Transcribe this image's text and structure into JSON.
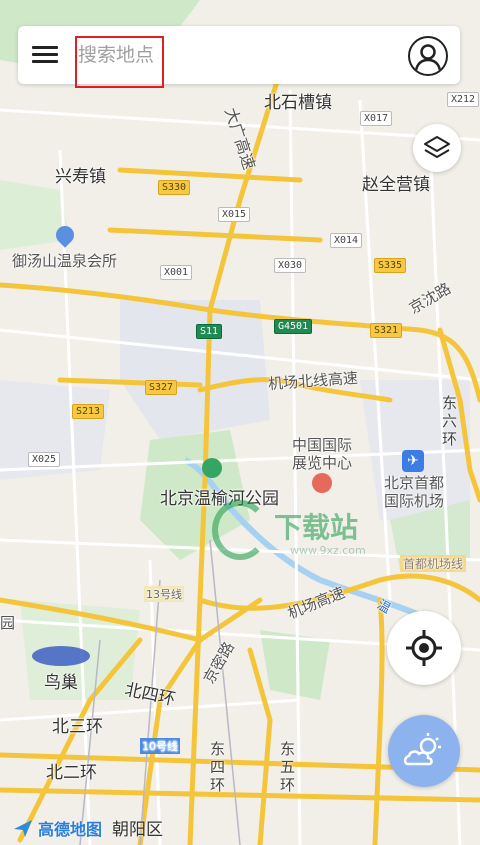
{
  "search": {
    "placeholder": "搜索地点"
  },
  "labels": {
    "beishicao": "北石槽镇",
    "xingshou": "兴寿镇",
    "zhaoquanying": "赵全营镇",
    "yutangshan": "御汤山温泉会所",
    "jingshen": "京沈路",
    "jichang_north": "机场北线高速",
    "expo": "中国国际\n展览中心",
    "wenyu": "北京温榆河公园",
    "airport": "北京首都\n国际机场",
    "airport_line": "首都机场线",
    "jichang_hw": "机场高速",
    "wen": "温",
    "yuan": "园",
    "niaochao": "鸟巢",
    "bei4": "北四环",
    "bei3": "北三环",
    "bei2": "北二环",
    "jingmi": "京密路",
    "line13": "13号线",
    "line10": "10号线",
    "dongliuhuan": "东六环",
    "dadong": "大广高速",
    "dongsihuan": "东四环",
    "dongwuhuan": "东五环",
    "district": "朝阳区"
  },
  "shields": {
    "s330": "S330",
    "x015": "X015",
    "x014": "X014",
    "x030": "X030",
    "s335": "S335",
    "x001": "X001",
    "s11": "S11",
    "g4501": "G4501",
    "s321": "S321",
    "s327": "S327",
    "s213": "S213",
    "x025": "X025",
    "x017": "X017",
    "x212": "X212"
  },
  "logo": {
    "text": "高德地图"
  },
  "watermark": {
    "text": "下载站",
    "url": "www.9xz.com"
  },
  "icons": [
    "menu-icon",
    "user-icon",
    "layers-icon",
    "locate-icon",
    "weather-icon",
    "airport-icon"
  ],
  "colors": {
    "highway": "#f4c53b",
    "road": "#ffffff",
    "green": "#c9e9c3",
    "water": "#a6d1f2"
  }
}
